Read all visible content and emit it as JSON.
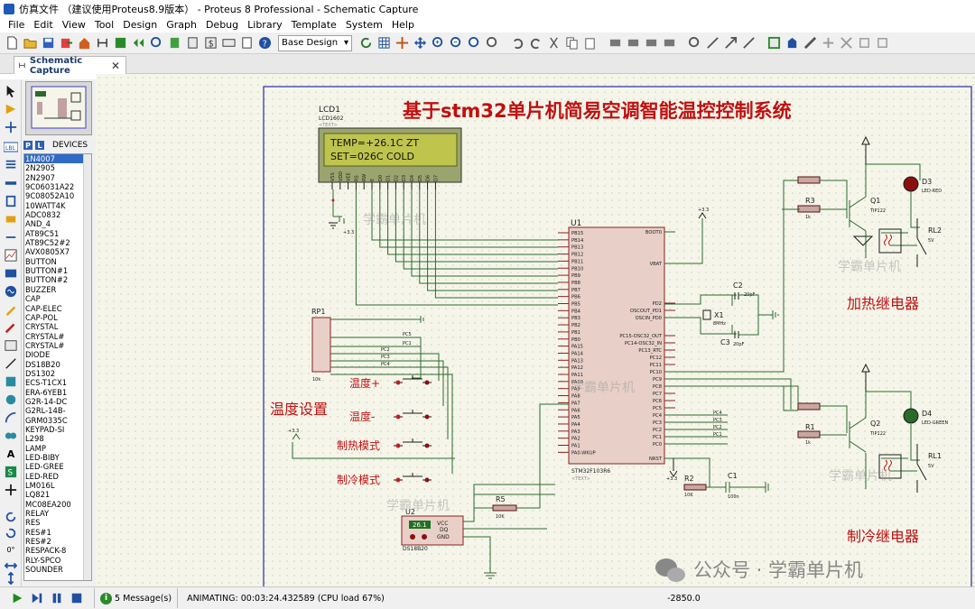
{
  "window": {
    "title": "仿真文件 （建议使用Proteus8.9版本） - Proteus 8 Professional - Schematic Capture"
  },
  "menu": [
    "File",
    "Edit",
    "View",
    "Tool",
    "Design",
    "Graph",
    "Debug",
    "Library",
    "Template",
    "System",
    "Help"
  ],
  "toolbar": {
    "design_combo": "Base Design"
  },
  "tab": {
    "label": "Schematic Capture"
  },
  "devices": {
    "header": "DEVICES",
    "items": [
      "1N4007",
      "2N2905",
      "2N2907",
      "9C06031A22",
      "9C08052A10",
      "10WATT4K",
      "ADC0832",
      "AND_4",
      "AT89C51",
      "AT89C52#2",
      "AVX0805X7",
      "BUTTON",
      "BUTTON#1",
      "BUTTON#2",
      "BUZZER",
      "CAP",
      "CAP-ELEC",
      "CAP-POL",
      "CRYSTAL",
      "CRYSTAL#",
      "CRYSTAL#",
      "DIODE",
      "DS18B20",
      "DS1302",
      "ECS-T1CX1",
      "ERA-6YEB1",
      "G2R-14-DC",
      "G2RL-14B-",
      "GRM0335C",
      "KEYPAD-SI",
      "L298",
      "LAMP",
      "LED-BIBY",
      "LED-GREE",
      "LED-RED",
      "LM016L",
      "LQ821",
      "MC08EA200",
      "RELAY",
      "RES",
      "RES#1",
      "RES#2",
      "RESPACK-8",
      "RLY-SPCO",
      "SOUNDER"
    ],
    "selected": "1N4007"
  },
  "left_panel": {
    "rotation": "0°"
  },
  "schematic": {
    "title": "基于stm32单片机简易空调智能温控控制系统",
    "watermark": "学霸单片机",
    "wechat": "公众号 · 学霸单片机",
    "lcd": {
      "ref": "LCD1",
      "part": "LCD1602",
      "line1": "TEMP=+26.1C  ZT",
      "line2": " SET=026C   COLD",
      "pins": [
        "VSS",
        "VDD",
        "VEE",
        "RS",
        "RW",
        "E",
        "D0",
        "D1",
        "D2",
        "D3",
        "D4",
        "D5",
        "D6",
        "D7"
      ]
    },
    "mcu": {
      "ref": "U1",
      "part": "STM32F103R6",
      "left_pins": [
        "PB15",
        "PB14",
        "PB13",
        "PB12",
        "PB11",
        "PB10",
        "PB9",
        "PB8",
        "PB7",
        "PB6",
        "PB5",
        "PB4",
        "PB3",
        "PB2",
        "PB1",
        "PB0",
        "PA15",
        "PA14",
        "PA13",
        "PA12",
        "PA11",
        "PA10",
        "PA9",
        "PA8",
        "PA7",
        "PA6",
        "PA5",
        "PA4",
        "PA3",
        "PA2",
        "PA1",
        "PA0-WKUP"
      ],
      "right_pins": [
        "BOOT0",
        "VBAT",
        "PD2",
        "OSCOUT_PD1",
        "OSCIN_PD0",
        "PC15-OSC32_OUT",
        "PC14-OSC32_IN",
        "PC13_RTC",
        "PC12",
        "PC11",
        "PC10",
        "PC9",
        "PC8",
        "PC7",
        "PC6",
        "PC5",
        "PC4",
        "PC3",
        "PC2",
        "PC1",
        "PC0",
        "NRST"
      ]
    },
    "rp": {
      "ref": "RP1",
      "part": "10k"
    },
    "labels": {
      "temp_setting": "温度设置",
      "temp_up": "温度+",
      "temp_down": "温度-",
      "heat_mode": "制热模式",
      "cool_mode": "制冷模式",
      "heat_relay": "加热继电器",
      "cool_relay": "制冷继电器"
    },
    "parts": {
      "q1": "Q1",
      "q2": "Q2",
      "tip": "TIP122",
      "r1": "R1",
      "r2": "R2",
      "r3": "R3",
      "r5": "R5",
      "r_val": "1k",
      "r10k": "10K",
      "c1": "C1",
      "c1_val": "100n",
      "c2": "C2",
      "c3": "C3",
      "c_val": "20pF",
      "x1": "X1",
      "x1_val": "8MHz",
      "d3": "D3",
      "d3_part": "LED-RED",
      "d4": "D4",
      "d4_part": "LED-GREEN",
      "rl1": "RL1",
      "rl2": "RL2",
      "rl_val": "5V",
      "u2": "U2",
      "ds": "DS18B20",
      "ds_temp": "26.1",
      "text": "<TEXT>",
      "vcc": "+3.3",
      "pc5": "PC5",
      "pc1": "PC1",
      "pc2": "PC2",
      "pc3": "PC3",
      "pc4": "PC4"
    }
  },
  "status": {
    "messages": "5 Message(s)",
    "animating": "ANIMATING: 00:03:24.432589 (CPU load 67%)",
    "coord": "-2850.0"
  }
}
